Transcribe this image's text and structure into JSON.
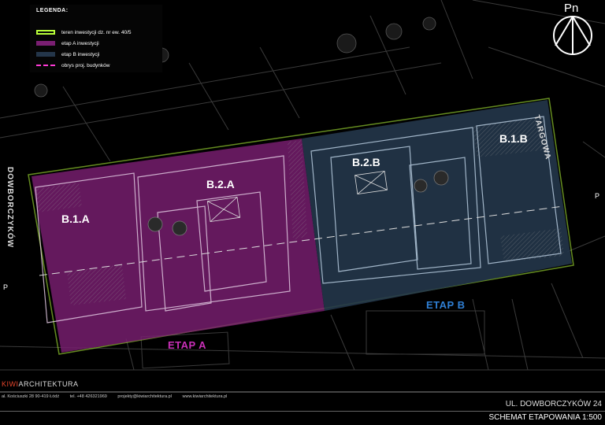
{
  "legend": {
    "title": "LEGENDA:",
    "items": [
      {
        "label": "teren inwestycji dz. nr ew. 40/5",
        "color": "#b8ff3a"
      },
      {
        "label": "etap A inwestycji",
        "color": "#7a1f72"
      },
      {
        "label": "etap B inwestycji",
        "color": "#24364a"
      },
      {
        "label": "obrys proj. budynków",
        "color": "#ff3ad6"
      }
    ]
  },
  "north_label": "Pn",
  "buildings": {
    "b1a": "B.1.A",
    "b2a": "B.2.A",
    "b2b": "B.2.B",
    "b1b": "B.1.B"
  },
  "stages": {
    "a": "ETAP A",
    "b": "ETAP B"
  },
  "streets": {
    "targowa": "TARGOWA",
    "dowborczykow": "DOWBORCZYKÓW"
  },
  "entrances": {
    "left": "P",
    "right": "P"
  },
  "colors": {
    "stage_a": "#c930b8",
    "stage_b": "#2f7fd4",
    "accent": "#e8452b"
  },
  "footer": {
    "company_accent": "KIWI",
    "company_rest": "ARCHITEKTURA",
    "address": "al. Kościuszki 28 90-419 Łódź",
    "phone": "tel. +48 426321969",
    "email": "projekty@kiwiarchitektura.pl",
    "web": "www.kiwiarchitektura.pl",
    "project_title": "UL. DOWBORCZYKÓW 24",
    "sheet_title": "SCHEMAT ETAPOWANIA 1:500"
  }
}
